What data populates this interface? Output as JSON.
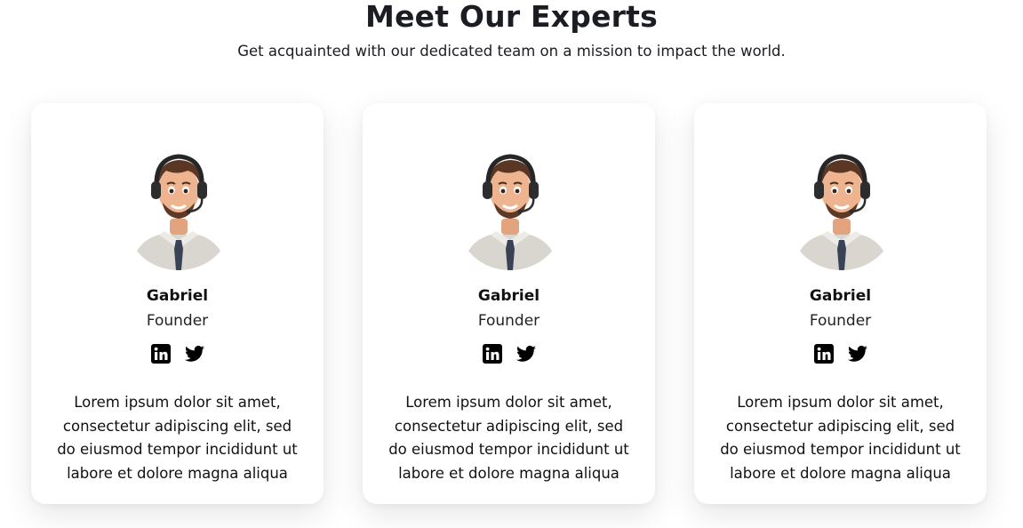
{
  "section": {
    "title": "Meet Our Experts",
    "subtitle": "Get acquainted with our dedicated team on a mission to impact the world."
  },
  "colors": {
    "text": "#111111",
    "card_background": "#ffffff",
    "page_background": "#ffffff"
  },
  "cards": [
    {
      "name": "Gabriel",
      "role": "Founder",
      "avatar_icon": "support-agent-avatar",
      "socials": [
        "linkedin-icon",
        "twitter-icon"
      ],
      "bio": "Lorem ipsum dolor sit amet, consectetur adipiscing elit, sed do eiusmod tempor incididunt ut labore et dolore magna aliqua"
    },
    {
      "name": "Gabriel",
      "role": "Founder",
      "avatar_icon": "support-agent-avatar",
      "socials": [
        "linkedin-icon",
        "twitter-icon"
      ],
      "bio": "Lorem ipsum dolor sit amet, consectetur adipiscing elit, sed do eiusmod tempor incididunt ut labore et dolore magna aliqua"
    },
    {
      "name": "Gabriel",
      "role": "Founder",
      "avatar_icon": "support-agent-avatar",
      "socials": [
        "linkedin-icon",
        "twitter-icon"
      ],
      "bio": "Lorem ipsum dolor sit amet, consectetur adipiscing elit, sed do eiusmod tempor incididunt ut labore et dolore magna aliqua"
    }
  ]
}
